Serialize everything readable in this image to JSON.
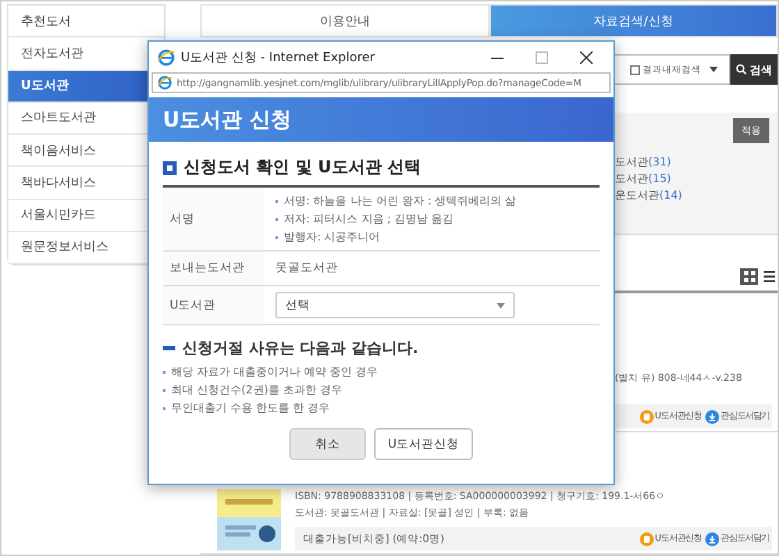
{
  "sidebar": {
    "items": [
      {
        "label": "추천도서",
        "selected": false
      },
      {
        "label": "전자도서관",
        "selected": false
      },
      {
        "label": "U도서관",
        "selected": true
      },
      {
        "label": "스마트도서관",
        "selected": false
      },
      {
        "label": "책이음서비스",
        "selected": false
      },
      {
        "label": "책바다서비스",
        "selected": false
      },
      {
        "label": "서울시민카드",
        "selected": false
      },
      {
        "label": "원문정보서비스",
        "selected": false
      }
    ]
  },
  "tabs": [
    {
      "label": "이용안내",
      "selected": false
    },
    {
      "label": "자료검색/신청",
      "selected": true
    }
  ],
  "search": {
    "checkbox_label": "결과내재검색",
    "checked": false,
    "button": "검색"
  },
  "filter": {
    "button": "적용",
    "items": [
      "도서관(31)",
      "도서관(15)",
      "운도서관(14)"
    ]
  },
  "view_modes": [
    {
      "kind": "grid",
      "selected": true
    },
    {
      "kind": "list",
      "selected": false
    }
  ],
  "results": [
    {
      "lines": [
        "(별치 유) 808-네44ㅅ-v.238"
      ],
      "actions": [
        "U도서관신청",
        "관심도서담기"
      ]
    },
    {
      "lines": [
        "ISBN: 9788908833108 | 등록번호: SA000000003992 | 청구기호: 199.1-서66ㅇ",
        "도서관: 못골도서관 | 자료실: [못골] 성인 | 부록: 없음"
      ],
      "status": "대출가능[비치중] (예약:0명)",
      "actions": [
        "U도서관신청",
        "관심도서담기"
      ],
      "picture": {
        "kind": "picture"
      }
    }
  ],
  "popup": {
    "window_title": "U도서관 신청 - Internet Explorer",
    "address": "http://gangnamlib.yesjnet.com/mglib/ulibrary/ulibraryLillApplyPop.do?manageCode=M",
    "header": "U도서관 신청",
    "section_title": "신청도서 확인 및 U도서관 선택",
    "rows": [
      {
        "label": "서명",
        "kind": "list",
        "values": [
          "서명: 하늘을 나는 어린 왕자 : 생텍쥐베리의 삶",
          "저자: 피터시스 지음 ; 김명남 옮김",
          "발행자: 시공주니어"
        ]
      },
      {
        "label": "보내는도서관",
        "kind": "text",
        "values": [
          "못골도서관"
        ]
      },
      {
        "label": "U도서관",
        "kind": "select",
        "values": [
          "선택"
        ]
      }
    ],
    "notice_title": "신청거절 사유는 다음과 같습니다.",
    "notices": [
      "해당 자료가 대출중이거나 예약 중인 경우",
      "최대 신청건수(2권)를 초과한 경우",
      "무인대출기 수용 한도를 한 경우"
    ],
    "buttons": [
      {
        "label": "취소",
        "kind": "secondary"
      },
      {
        "label": "U도서관신청",
        "kind": "primary"
      }
    ]
  }
}
